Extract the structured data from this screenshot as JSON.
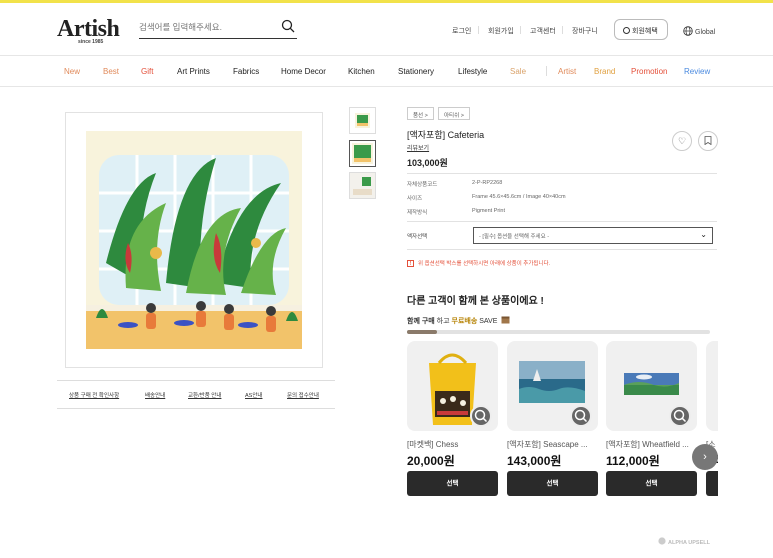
{
  "header": {
    "logo": "Artish",
    "logo_sub": "since 1985",
    "search_placeholder": "검색어를 입력해주세요.",
    "util": [
      "로그인",
      "회원가입",
      "고객센터",
      "장바구니"
    ],
    "benefit_label": "회원혜택",
    "global_label": "Global"
  },
  "nav": {
    "items": [
      {
        "label": "New",
        "color": "#e08a5a"
      },
      {
        "label": "Best",
        "color": "#e08a5a"
      },
      {
        "label": "Gift",
        "color": "#e4503a"
      },
      {
        "label": "Art Prints",
        "color": "#222222"
      },
      {
        "label": "Fabrics",
        "color": "#222222"
      },
      {
        "label": "Home Decor",
        "color": "#222222"
      },
      {
        "label": "Kitchen",
        "color": "#222222"
      },
      {
        "label": "Stationery",
        "color": "#222222"
      },
      {
        "label": "Lifestyle",
        "color": "#222222"
      },
      {
        "label": "Sale",
        "color": "#d9a26a"
      },
      {
        "label": "Artist",
        "color": "#e08a5a"
      },
      {
        "label": "Brand",
        "color": "#e0a040"
      },
      {
        "label": "Promotion",
        "color": "#e4503a"
      },
      {
        "label": "Review",
        "color": "#4a8adf"
      }
    ]
  },
  "info_tabs": [
    "상품 구매 전 확인사항",
    "배송안내",
    "교환/반품 안내",
    "AS안내",
    "문의 접수안내"
  ],
  "product": {
    "breadcrumbs": [
      "품선 >",
      "아티쉬 >"
    ],
    "title": "[액자포함] Cafeteria",
    "review_link": "리뷰보기",
    "price": "103,000원",
    "specs": [
      {
        "label": "자체상품코드",
        "value": "2-P-RP2268"
      },
      {
        "label": "사이즈",
        "value": "Frame 45.6×45.6cm / Image 40×40cm"
      },
      {
        "label": "제작방식",
        "value": "Pigment Print"
      }
    ],
    "option_label": "액자선택",
    "option_value": "- [필수] 옵션을 선택해 주세요 -",
    "notice": "위 옵션선택 박스를 선택하시면 아래에 상품이 추가됩니다."
  },
  "recommend": {
    "title": "다른 고객이 함께 본 상품이에요 !",
    "sub_a": "함께 구매",
    "sub_b": " 하고 ",
    "sub_c": "무료배송",
    "sub_d": " SAVE",
    "progress": 0.1,
    "cards": [
      {
        "name": "[마켓백] Chess",
        "price": "20,000원",
        "button": "선택"
      },
      {
        "name": "[액자포함] Seascape ...",
        "price": "143,000원",
        "button": "선택"
      },
      {
        "name": "[액자포함] Wheatfield ...",
        "price": "112,000원",
        "button": "선택"
      },
      {
        "name": "[소",
        "price": "12",
        "button": "선"
      }
    ],
    "next_label": "›"
  },
  "footer": {
    "brand": "ALPHA UPSELL"
  }
}
